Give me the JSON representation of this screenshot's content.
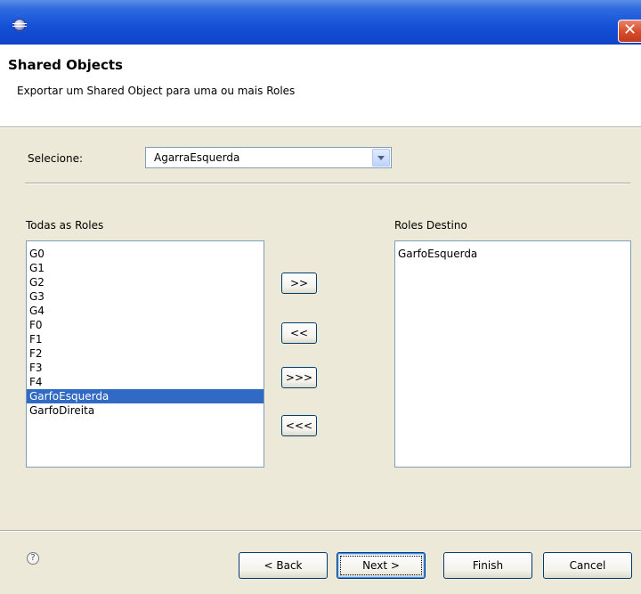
{
  "window": {
    "close_glyph": "✕"
  },
  "header": {
    "title": "Shared Objects",
    "description": "Exportar um Shared Object para uma ou mais Roles"
  },
  "selector": {
    "label": "Selecione:",
    "selected_value": "AgarraEsquerda"
  },
  "source_list": {
    "label": "Todas as Roles",
    "items": [
      "G0",
      "G1",
      "G2",
      "G3",
      "G4",
      "F0",
      "F1",
      "F2",
      "F3",
      "F4",
      "GarfoEsquerda",
      "GarfoDireita"
    ],
    "selected_item": "GarfoEsquerda"
  },
  "target_list": {
    "label": "Roles Destino",
    "items": [
      "GarfoEsquerda"
    ]
  },
  "transfer_buttons": {
    "add": ">>",
    "remove": "<<",
    "add_all": ">>>",
    "remove_all": "<<<"
  },
  "footer": {
    "help_glyph": "?",
    "back_label": "< Back",
    "next_label": "Next >",
    "finish_label": "Finish",
    "cancel_label": "Cancel"
  },
  "colors": {
    "titlebar": "#1450d6",
    "selection": "#316ac5",
    "dialog_bg": "#ece9d8"
  }
}
